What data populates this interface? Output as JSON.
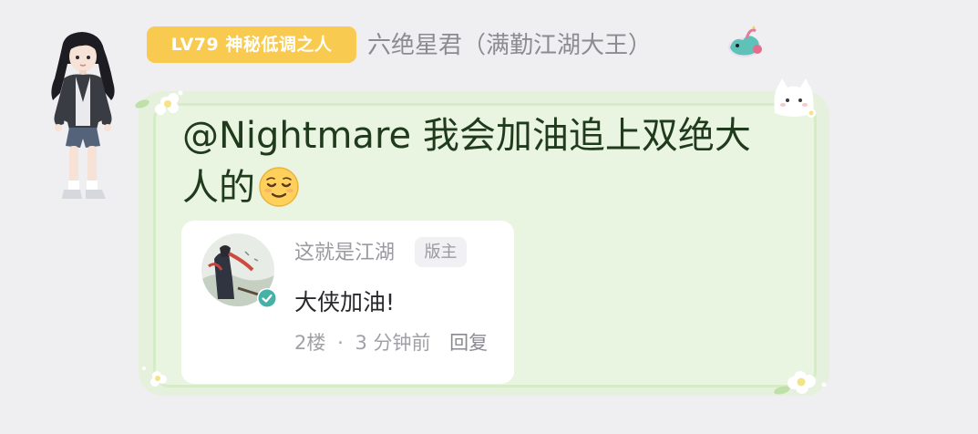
{
  "header": {
    "level_badge": "LV79 神秘低调之人",
    "username": "六绝星君（满勤江湖大王）"
  },
  "message": {
    "text": "@Nightmare 我会加油追上双绝大人的",
    "emoji": "relieved-face"
  },
  "reply": {
    "author": "这就是江湖",
    "role_badge": "版主",
    "text": "大侠加油!",
    "floor": "2楼",
    "separator": "·",
    "time": "3 分钟前",
    "reply_label": "回复"
  },
  "colors": {
    "badge_bg": "#f8ca4f",
    "bubble_bg": "#e9f5e0",
    "verified": "#46b1a7"
  }
}
